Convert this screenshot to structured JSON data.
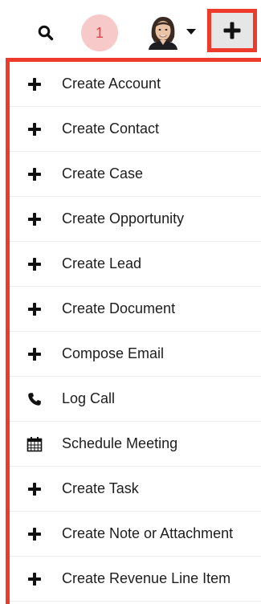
{
  "header": {
    "search_icon": "search-icon",
    "notification_count": "1",
    "notification_colors": {
      "background": "#f8c9c9",
      "text": "#e0454a"
    },
    "quickcreate_icon": "plus-icon",
    "highlight_color": "#ee3a2a"
  },
  "menu": {
    "items": [
      {
        "icon": "plus-icon",
        "label": "Create Account"
      },
      {
        "icon": "plus-icon",
        "label": "Create Contact"
      },
      {
        "icon": "plus-icon",
        "label": "Create Case"
      },
      {
        "icon": "plus-icon",
        "label": "Create Opportunity"
      },
      {
        "icon": "plus-icon",
        "label": "Create Lead"
      },
      {
        "icon": "plus-icon",
        "label": "Create Document"
      },
      {
        "icon": "plus-icon",
        "label": "Compose Email"
      },
      {
        "icon": "phone-icon",
        "label": "Log Call"
      },
      {
        "icon": "calendar-icon",
        "label": "Schedule Meeting"
      },
      {
        "icon": "plus-icon",
        "label": "Create Task"
      },
      {
        "icon": "plus-icon",
        "label": "Create Note or Attachment"
      },
      {
        "icon": "plus-icon",
        "label": "Create Revenue Line Item"
      }
    ]
  }
}
